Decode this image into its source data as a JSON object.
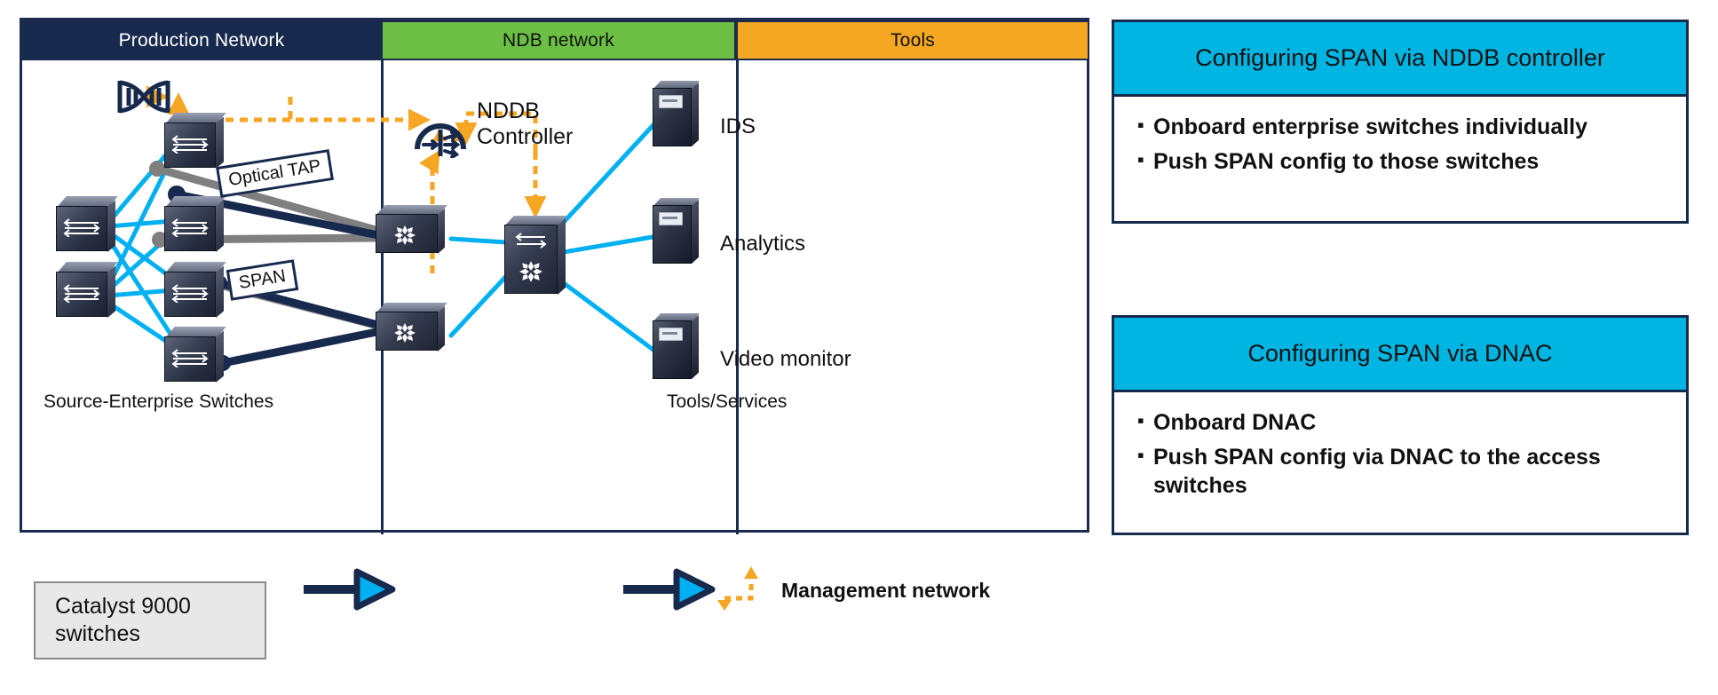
{
  "diagram": {
    "columns": [
      {
        "id": "production",
        "label": "Production Network"
      },
      {
        "id": "ndb",
        "label": "NDB network"
      },
      {
        "id": "tools",
        "label": "Tools"
      }
    ],
    "zone_labels": {
      "source": "Source-Enterprise Switches",
      "tools": "Tools/Services"
    },
    "controller": {
      "label_line1": "NDDB",
      "label_line2": "Controller",
      "icon": "ndb-controller-icon"
    },
    "dnac_icon": "dna-helix-icon",
    "tags": [
      {
        "id": "optical-tap",
        "label": "Optical TAP"
      },
      {
        "id": "span",
        "label": "SPAN"
      }
    ],
    "tools": [
      {
        "id": "ids",
        "label": "IDS"
      },
      {
        "id": "analytics",
        "label": "Analytics"
      },
      {
        "id": "video-monitor",
        "label": "Video monitor"
      }
    ]
  },
  "legend": {
    "catalyst_box": "Catalyst 9000\nswitches",
    "catalyst_line1": "Catalyst 9000",
    "catalyst_line2": "switches",
    "management_network": "Management network"
  },
  "panels": [
    {
      "id": "span-via-nddb",
      "title": "Configuring SPAN via NDDB controller",
      "bullets": [
        "Onboard enterprise switches individually",
        "Push SPAN config to those switches"
      ]
    },
    {
      "id": "span-via-dnac",
      "title": "Configuring SPAN via DNAC",
      "bullets": [
        "Onboard DNAC",
        "Push SPAN config via DNAC to the access switches"
      ]
    }
  ],
  "colors": {
    "navy": "#17294d",
    "green": "#6cbe45",
    "orange": "#f5a623",
    "cyan": "#00b5e2",
    "link_cyan": "#00b0f0",
    "link_gray": "#7f7f7f",
    "link_navy": "#17294d",
    "mgmt_orange": "#f5a623"
  }
}
